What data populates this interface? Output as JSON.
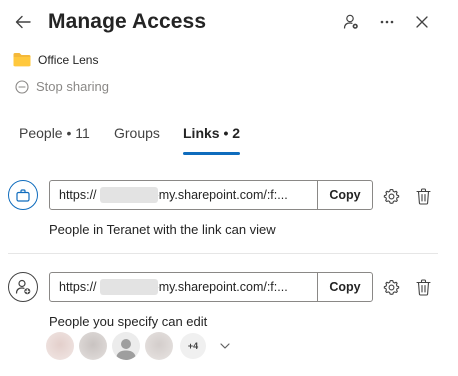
{
  "header": {
    "title": "Manage Access",
    "back_icon": "arrow-left-icon",
    "person_settings_icon": "person-gear-icon",
    "more_icon": "ellipsis-icon",
    "close_icon": "close-icon"
  },
  "item": {
    "name": "Office Lens",
    "icon": "folder-icon",
    "folder_color": "#F4B83A"
  },
  "stop_sharing": {
    "label": "Stop sharing",
    "icon": "minus-circle-icon"
  },
  "tabs": [
    {
      "label": "People • 11",
      "active": false
    },
    {
      "label": "Groups",
      "active": false
    },
    {
      "label": "Links • 2",
      "active": true
    }
  ],
  "links": [
    {
      "url": "https://            -my.sharepoint.com/:f:...",
      "url_prefix": "https://",
      "url_suffix": "-my.sharepoint.com/:f:...",
      "copy_label": "Copy",
      "description": "People in Teranet with the link can view",
      "icon": "briefcase-icon"
    },
    {
      "url": "https://            -my.sharepoint.com/:f:...",
      "url_prefix": "https://",
      "url_suffix": "-my.sharepoint.com/:f:...",
      "copy_label": "Copy",
      "description": "People you specify can edit",
      "icon": "person-add-icon"
    }
  ],
  "avatars": {
    "more_count": "+4"
  },
  "colors": {
    "accent": "#0F6CBD",
    "text": "#242424",
    "muted": "#8A8886"
  }
}
